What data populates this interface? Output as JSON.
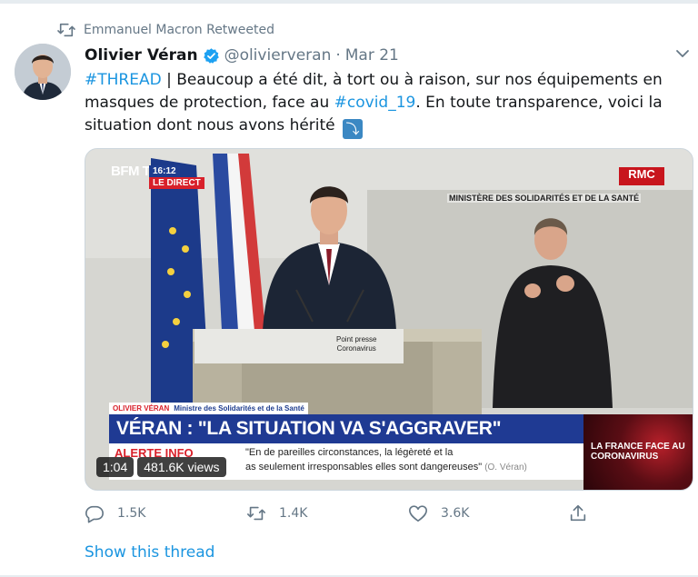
{
  "retweet_context": {
    "icon": "retweet-icon",
    "text": "Emmanuel Macron Retweeted"
  },
  "tweet": {
    "author_name": "Olivier Véran",
    "handle": "@olivierveran",
    "separator": "·",
    "date": "Mar 21",
    "verified_icon": "verified-badge-icon",
    "menu_icon": "chevron-down-icon",
    "text": {
      "hashtag1": "#THREAD",
      "part1": " | Beaucoup a été dit, à tort ou à raison, sur nos équipements en masques de protection, face au ",
      "hashtag2": "#covid_19",
      "part2": ". En toute transparence, voici la situation dont nous avons hérité ",
      "emoji": "⤵"
    }
  },
  "video": {
    "channel_logo": "BFM TV.",
    "time": "16:12",
    "live_label": "LE DIRECT",
    "rmc_logo": "RMC",
    "ministry_text": "MINISTÈRE DES SOLIDARITÉS ET DE LA SANTÉ",
    "podium_sign_l1": "Point presse",
    "podium_sign_l2": "Coronavirus",
    "lower_third": {
      "name": "OLIVIER VÉRAN",
      "role": "Ministre des Solidarités et de la Santé",
      "headline": "VÉRAN : \"LA SITUATION VA S'AGGRAVER\"",
      "alert": "ALERTE INFO",
      "quote_line1": "\"En de pareilles circonstances, la légèreté et la",
      "quote_line2": "as seulement irresponsables elles sont dangereuses\"",
      "quote_attribution": "(O. Véran)",
      "side_box": "LA FRANCE FACE AU CORONAVIRUS"
    },
    "duration": "1:04",
    "views": "481.6K views"
  },
  "actions": {
    "reply": {
      "icon": "reply-icon",
      "count": "1.5K"
    },
    "retweet": {
      "icon": "retweet-icon",
      "count": "1.4K"
    },
    "like": {
      "icon": "heart-icon",
      "count": "3.6K"
    },
    "share": {
      "icon": "share-icon"
    }
  },
  "show_thread": "Show this thread",
  "colors": {
    "link": "#1b95e0",
    "muted": "#657786",
    "verified": "#1da1f2",
    "bfm_blue": "#1f3a93",
    "alert_red": "#d8202a"
  }
}
